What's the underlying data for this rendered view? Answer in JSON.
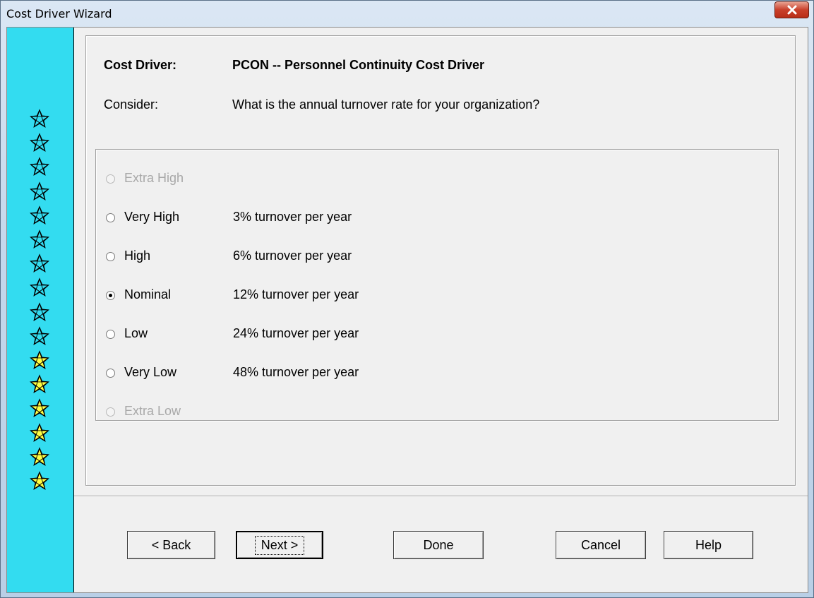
{
  "window": {
    "title": "Cost Driver Wizard"
  },
  "header": {
    "cost_driver_label": "Cost Driver:",
    "cost_driver_value": "PCON -- Personnel Continuity Cost Driver",
    "consider_label": "Consider:",
    "consider_value": "What is the annual turnover rate for your organization?"
  },
  "ratings": [
    {
      "label": "Extra High",
      "description": "",
      "enabled": false,
      "selected": false
    },
    {
      "label": "Very High",
      "description": "3% turnover per year",
      "enabled": true,
      "selected": false
    },
    {
      "label": "High",
      "description": "6% turnover per year",
      "enabled": true,
      "selected": false
    },
    {
      "label": "Nominal",
      "description": "12% turnover per year",
      "enabled": true,
      "selected": true
    },
    {
      "label": "Low",
      "description": "24% turnover per year",
      "enabled": true,
      "selected": false
    },
    {
      "label": "Very Low",
      "description": "48% turnover per year",
      "enabled": true,
      "selected": false
    },
    {
      "label": "Extra Low",
      "description": "",
      "enabled": false,
      "selected": false
    }
  ],
  "stars": {
    "outline_count": 10,
    "filled_count": 6,
    "filled_color": "#ffff44",
    "strip_color": "#33dcf0"
  },
  "buttons": {
    "back": "< Back",
    "next": "Next >",
    "done": "Done",
    "cancel": "Cancel",
    "help": "Help"
  }
}
